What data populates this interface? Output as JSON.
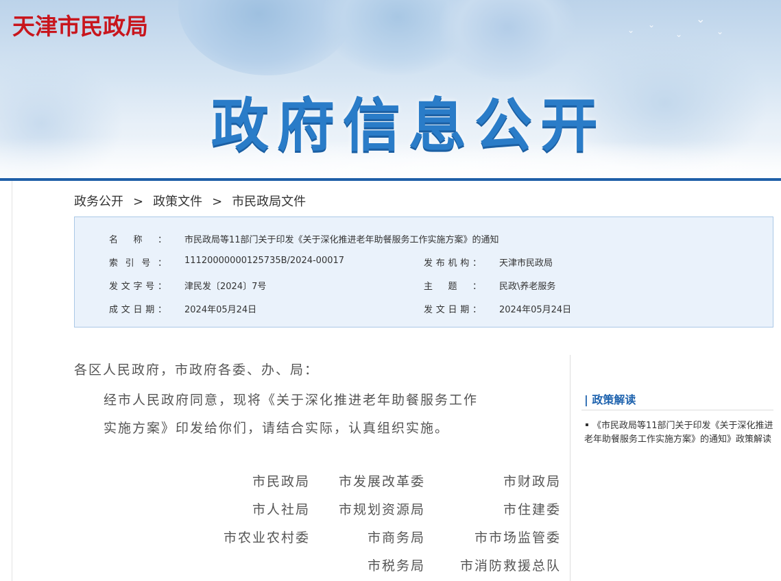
{
  "site": {
    "logo_text": "天津市民政局",
    "banner_title": "政府信息公开"
  },
  "breadcrumb": [
    "政务公开",
    "政策文件",
    "市民政局文件"
  ],
  "breadcrumb_separator": ">",
  "info": {
    "name_label": "名称：",
    "name_value": "市民政局等11部门关于印发《关于深化推进老年助餐服务工作实施方案》的通知",
    "index_label": "索引号：",
    "index_value": "11120000000125735B/2024-00017",
    "publisher_label": "发布机构：",
    "publisher_value": "天津市民政局",
    "doc_no_label": "发文字号：",
    "doc_no_value": "津民发〔2024〕7号",
    "subject_label": "主题：",
    "subject_value": "民政\\养老服务",
    "created_label": "成文日期：",
    "created_value": "2024年05月24日",
    "issued_label": "发文日期：",
    "issued_value": "2024年05月24日"
  },
  "letter": {
    "salutation": "各区人民政府，市政府各委、办、局：",
    "body_line1": "经市人民政府同意，现将《关于深化推进老年助餐服务工作",
    "body_line2": "实施方案》印发给你们，请结合实际，认真组织实施。"
  },
  "signers": [
    [
      "市民政局",
      "市发展改革委",
      "市财政局"
    ],
    [
      "市人社局",
      "市规划资源局",
      "市住建委"
    ],
    [
      "市农业农村委",
      "市商务局",
      "市市场监管委"
    ],
    [
      "",
      "市税务局",
      "市消防救援总队"
    ]
  ],
  "sidebar": {
    "title": "| 政策解读",
    "item": "《市民政局等11部门关于印发《关于深化推进老年助餐服务工作实施方案》的通知》政策解读"
  },
  "colors": {
    "logo_red": "#c8161d",
    "banner_title_blue": "#2a7cc8",
    "banner_line": "#1f5fa8",
    "info_box_bg": "#eaf2fb",
    "sidebar_title_blue": "#1f63ae"
  }
}
